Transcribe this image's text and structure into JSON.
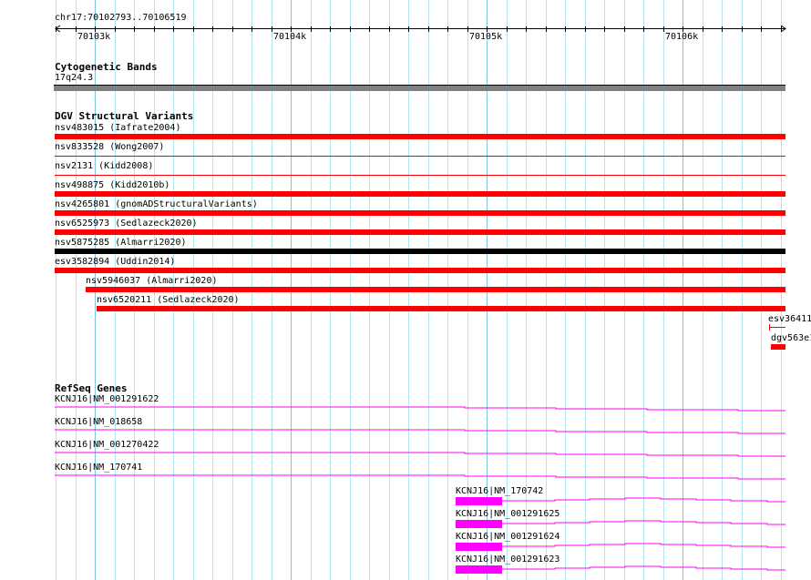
{
  "ruler": {
    "location": "chr17:70102793..70106519",
    "ticks": [
      "70103k",
      "70104k",
      "70105k",
      "70106k"
    ]
  },
  "cytobands": {
    "title": "Cytogenetic Bands",
    "band": "17q24.3",
    "color": "#808080"
  },
  "dgv": {
    "title": "DGV Structural Variants",
    "items": [
      {
        "label": "nsv483015 (Iafrate2004)",
        "style": "thick",
        "color": "#ff0000"
      },
      {
        "label": "nsv833528 (Wong2007)",
        "style": "thin",
        "color": "#ff0000"
      },
      {
        "label": "nsv2131 (Kidd2008)",
        "style": "thin",
        "color": "#ff0000"
      },
      {
        "label": "nsv498875 (Kidd2010b)",
        "style": "thick",
        "color": "#ff0000"
      },
      {
        "label": "nsv4265801 (gnomADStructuralVariants)",
        "style": "thick",
        "color": "#ff0000"
      },
      {
        "label": "nsv6525973 (Sedlazeck2020)",
        "style": "thick",
        "color": "#ff0000"
      },
      {
        "label": "nsv5875285 (Almarri2020)",
        "style": "thick",
        "color": "#000000"
      },
      {
        "label": "esv3582894 (Uddin2014)",
        "style": "thick",
        "color": "#ff0000"
      },
      {
        "label": "nsv5946037 (Almarri2020)",
        "style": "thick",
        "color": "#ff0000"
      },
      {
        "label": "nsv6520211 (Sedlazeck2020)",
        "style": "thick",
        "color": "#ff0000"
      },
      {
        "label": "esv36411",
        "style": "thin",
        "color": "#ff0000"
      },
      {
        "label": "dgv563e1",
        "style": "thick",
        "color": "#ff0000"
      }
    ]
  },
  "refseq": {
    "title": "RefSeq Genes",
    "color": "#ff00ff",
    "items": [
      {
        "label": "KCNJ16|NM_001291622"
      },
      {
        "label": "KCNJ16|NM_018658"
      },
      {
        "label": "KCNJ16|NM_001270422"
      },
      {
        "label": "KCNJ16|NM_170741"
      },
      {
        "label": "KCNJ16|NM_170742"
      },
      {
        "label": "KCNJ16|NM_001291625"
      },
      {
        "label": "KCNJ16|NM_001291624"
      },
      {
        "label": "KCNJ16|NM_001291623"
      }
    ]
  }
}
